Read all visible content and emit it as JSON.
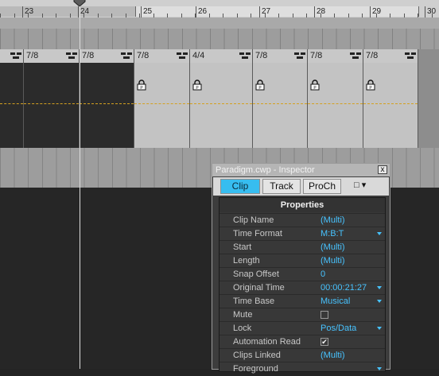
{
  "ruler": {
    "bars": [
      "23",
      "24",
      "25",
      "26",
      "27",
      "28",
      "29",
      "30"
    ]
  },
  "clips": [
    {
      "meter": "",
      "shade": "dark"
    },
    {
      "meter": "7/8",
      "shade": "dark"
    },
    {
      "meter": "7/8",
      "shade": "dark"
    },
    {
      "meter": "7/8",
      "shade": "light"
    },
    {
      "meter": "4/4",
      "shade": "light"
    },
    {
      "meter": "7/8",
      "shade": "light"
    },
    {
      "meter": "7/8",
      "shade": "light"
    },
    {
      "meter": "7/8",
      "shade": "light"
    }
  ],
  "inspector": {
    "title": "Paradigm.cwp - Inspector",
    "close": "x",
    "tabs": [
      "Clip",
      "Track",
      "ProCh"
    ],
    "menu": "□ ▾",
    "properties_header": "Properties",
    "rows": [
      {
        "label": "Clip Name",
        "value": "(Multi)",
        "dropdown": false
      },
      {
        "label": "Time Format",
        "value": "M:B:T",
        "dropdown": true
      },
      {
        "label": "Start",
        "value": "(Multi)",
        "dropdown": false
      },
      {
        "label": "Length",
        "value": "(Multi)",
        "dropdown": false
      },
      {
        "label": "Snap Offset",
        "value": "0",
        "dropdown": false
      },
      {
        "label": "Original Time",
        "value": "00:00:21:27",
        "dropdown": true
      },
      {
        "label": "Time Base",
        "value": "Musical",
        "dropdown": true
      },
      {
        "label": "Mute",
        "checkbox": true,
        "checked": false
      },
      {
        "label": "Lock",
        "value": "Pos/Data",
        "dropdown": true
      },
      {
        "label": "Automation Read",
        "checkbox": true,
        "checked": true
      },
      {
        "label": "Clips Linked",
        "value": "(Multi)",
        "dropdown": false
      },
      {
        "label": "Foreground",
        "value": "",
        "dropdown": true
      }
    ]
  },
  "colors": {
    "accent": "#37bdf0",
    "value_text": "#47c3ff",
    "automation_line": "#d4a020"
  }
}
